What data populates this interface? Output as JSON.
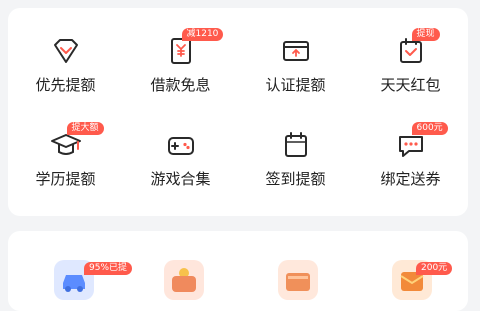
{
  "features": {
    "row1": [
      {
        "label": "优先提额",
        "icon": "diamond-icon"
      },
      {
        "label": "借款免息",
        "icon": "yen-doc-icon",
        "badge": "减1210"
      },
      {
        "label": "认证提额",
        "icon": "id-card-icon"
      },
      {
        "label": "天天红包",
        "icon": "calendar-check-icon",
        "badge": "提现"
      }
    ],
    "row2": [
      {
        "label": "学历提额",
        "icon": "graduation-cap-icon",
        "badge": "提大额"
      },
      {
        "label": "游戏合集",
        "icon": "gamepad-icon"
      },
      {
        "label": "签到提额",
        "icon": "calendar-icon"
      },
      {
        "label": "绑定送券",
        "icon": "chat-bubble-icon",
        "badge": "600元"
      }
    ]
  },
  "services": [
    {
      "icon": "car-icon",
      "badge": "95%已提",
      "color": "#5b8cff"
    },
    {
      "icon": "wallet-icon",
      "color": "#f08a5d"
    },
    {
      "icon": "purse-icon",
      "color": "#f0905a"
    },
    {
      "icon": "red-envelope-icon",
      "badge": "200元",
      "color": "#f28a3a"
    }
  ],
  "colors": {
    "accent": "#ff5a4c",
    "icon_stroke": "#2a2a2a"
  }
}
